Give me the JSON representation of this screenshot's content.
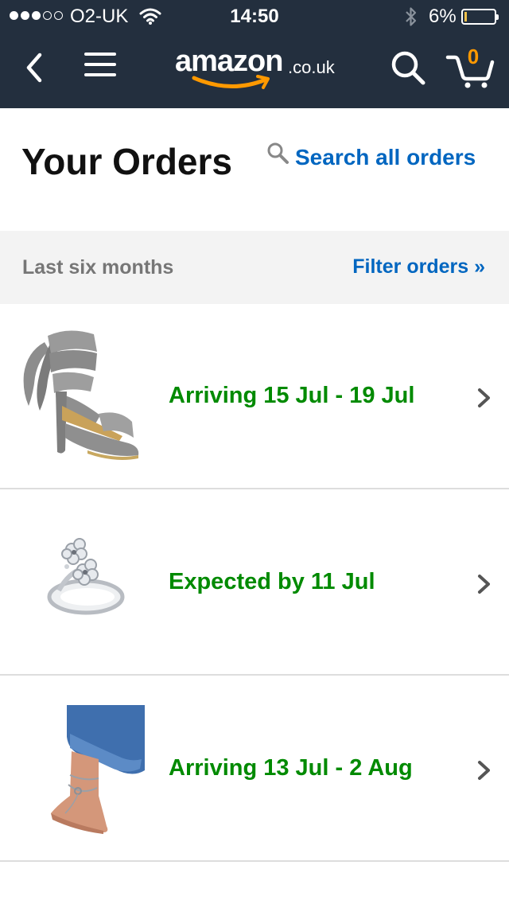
{
  "status_bar": {
    "carrier": "O2-UK",
    "time": "14:50",
    "battery_pct": "6%",
    "battery_level": 0.06
  },
  "nav": {
    "logo_main": "amazon",
    "logo_tld": ".co.uk",
    "cart_count": "0"
  },
  "header": {
    "title": "Your Orders",
    "search_label": "Search all orders"
  },
  "filter": {
    "range": "Last six months",
    "link": "Filter orders »"
  },
  "orders": [
    {
      "status": "Arriving 15 Jul - 19 Jul",
      "image": "grey-wrap-heel-sandal"
    },
    {
      "status": "Expected by 11 Jul",
      "image": "silver-flower-toe-ring"
    },
    {
      "status": "Arriving 13 Jul - 2 Aug",
      "image": "silver-anklet-on-foot"
    }
  ],
  "colors": {
    "nav_bg": "#232f3e",
    "link_blue": "#0066c0",
    "status_green": "#008a00",
    "accent_orange": "#ff9900"
  }
}
